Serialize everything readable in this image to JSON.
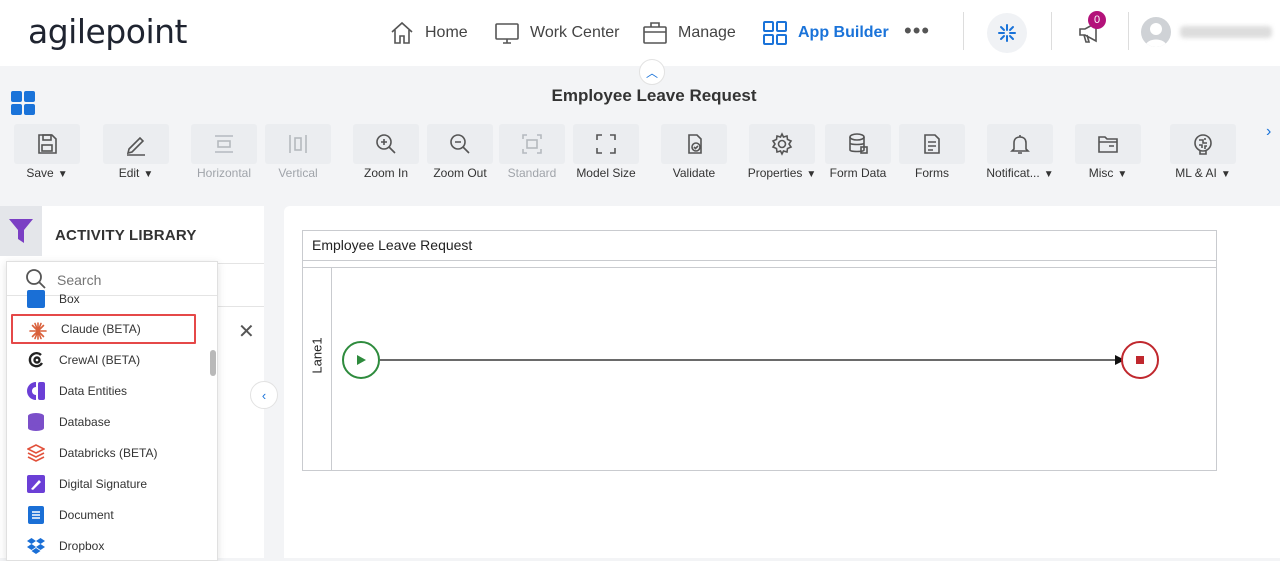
{
  "brand": {
    "logo_text": "agilepoint"
  },
  "nav": {
    "items": [
      {
        "label": "Home",
        "icon": "home-icon"
      },
      {
        "label": "Work Center",
        "icon": "monitor-icon"
      },
      {
        "label": "Manage",
        "icon": "briefcase-icon"
      },
      {
        "label": "App Builder",
        "icon": "grid-icon",
        "active": true
      }
    ],
    "more": "•••",
    "notification_count": "0"
  },
  "page": {
    "title": "Employee Leave Request"
  },
  "toolbar": {
    "items": [
      {
        "label": "Save",
        "icon": "save-icon",
        "dropdown": true
      },
      {
        "label": "Edit",
        "icon": "pencil-icon",
        "dropdown": true
      },
      {
        "label": "Horizontal",
        "icon": "horizontal-layout-icon",
        "disabled": true
      },
      {
        "label": "Vertical",
        "icon": "vertical-layout-icon",
        "disabled": true
      },
      {
        "label": "Zoom In",
        "icon": "zoom-in-icon"
      },
      {
        "label": "Zoom Out",
        "icon": "zoom-out-icon"
      },
      {
        "label": "Standard",
        "icon": "standard-size-icon",
        "disabled": true
      },
      {
        "label": "Model Size",
        "icon": "fit-size-icon"
      },
      {
        "label": "Validate",
        "icon": "validate-icon"
      },
      {
        "label": "Properties",
        "icon": "gear-icon",
        "dropdown": true
      },
      {
        "label": "Form Data",
        "icon": "database-icon"
      },
      {
        "label": "Forms",
        "icon": "forms-icon"
      },
      {
        "label": "Notificat...",
        "icon": "bell-icon",
        "dropdown": true
      },
      {
        "label": "Misc",
        "icon": "folder-icon",
        "dropdown": true
      },
      {
        "label": "ML & AI",
        "icon": "brain-icon",
        "dropdown": true
      }
    ]
  },
  "library": {
    "title": "ACTIVITY LIBRARY",
    "search_placeholder": "Search",
    "items": [
      {
        "label": "Box",
        "icon": "box-icon",
        "color": "#1a6fd6"
      },
      {
        "label": "Claude (BETA)",
        "icon": "claude-icon",
        "color": "#d9603b",
        "highlighted": true
      },
      {
        "label": "CrewAI (BETA)",
        "icon": "crewai-icon",
        "color": "#222222"
      },
      {
        "label": "Data Entities",
        "icon": "data-entities-icon",
        "color": "#6b3fd6"
      },
      {
        "label": "Database",
        "icon": "database-icon",
        "color": "#7b4fc9"
      },
      {
        "label": "Databricks (BETA)",
        "icon": "databricks-icon",
        "color": "#e2513b"
      },
      {
        "label": "Digital Signature",
        "icon": "signature-icon",
        "color": "#6b3fd6"
      },
      {
        "label": "Document",
        "icon": "document-icon",
        "color": "#1a6fd6"
      },
      {
        "label": "Dropbox",
        "icon": "dropbox-icon",
        "color": "#1a6fd6"
      }
    ]
  },
  "process": {
    "pool_title": "Employee Leave Request",
    "lane_label": "Lane1"
  },
  "colors": {
    "accent": "#1a73d9",
    "start_event": "#2e8b3d",
    "end_event": "#c0282e",
    "highlight_border": "#e54848",
    "filter_icon": "#7b3fc4"
  }
}
